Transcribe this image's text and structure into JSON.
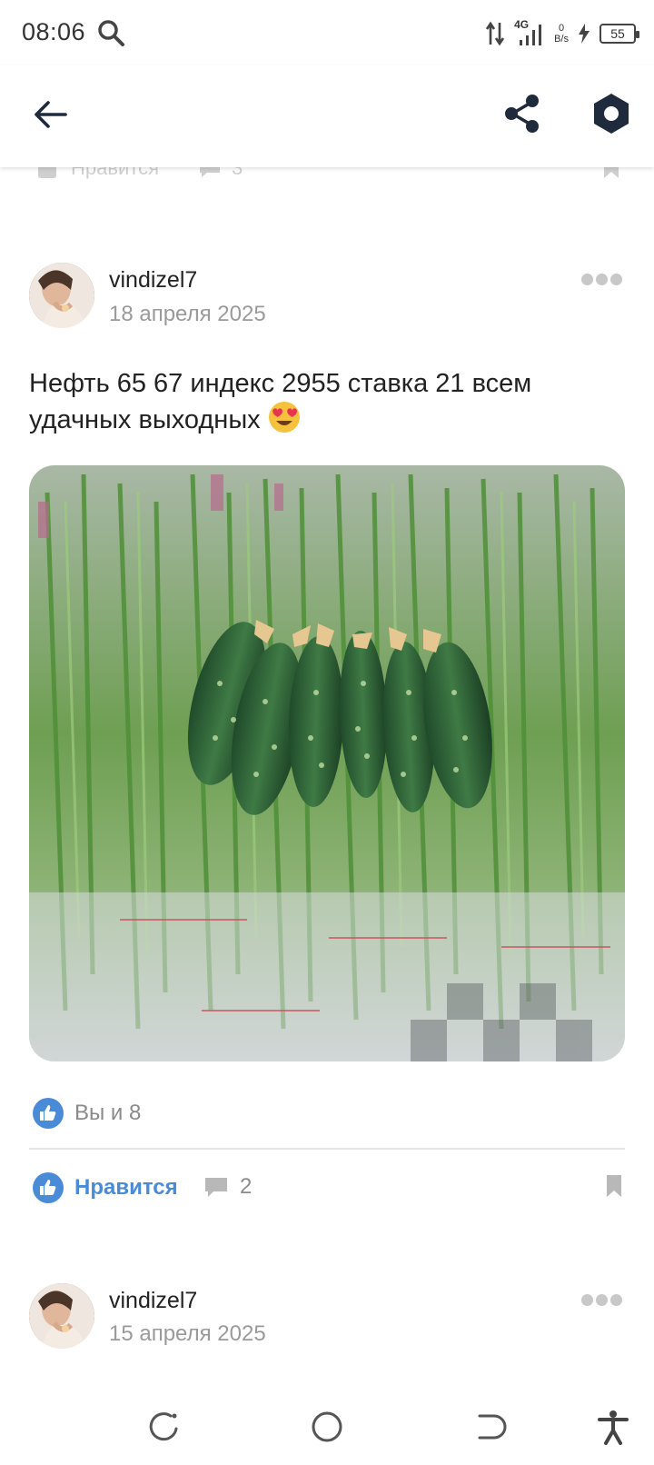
{
  "status_bar": {
    "time": "08:06",
    "network": "4G",
    "speed_value": "0",
    "speed_unit": "B/s",
    "battery": "55"
  },
  "app_bar": {
    "icons": [
      "back-arrow-icon",
      "share-icon",
      "settings-hexagon-icon"
    ]
  },
  "previous_post": {
    "like_label": "Нравится",
    "comments_count": "3"
  },
  "posts": [
    {
      "author": "vindizel7",
      "date": "18 апреля 2025",
      "text": "Нефть 65 67 индекс 2955  ставка 21 всем удачных выходных",
      "emoji": "heart-eyes",
      "image_description": "cucumbers-on-green-onions",
      "likes_summary": "Вы и 8",
      "like_label": "Нравится",
      "comments_count": "2"
    },
    {
      "author": "vindizel7",
      "date": "15 апреля 2025"
    }
  ],
  "colors": {
    "accent": "#4a8bd8",
    "muted": "#8a8a8a",
    "date": "#9a9a9a",
    "app_icons": "#1f2a3c"
  }
}
